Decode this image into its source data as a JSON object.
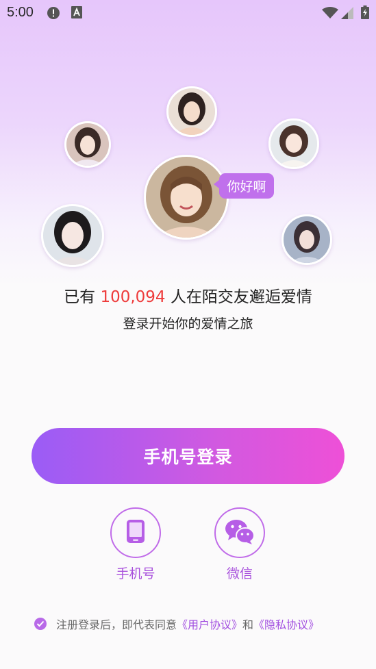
{
  "status_bar": {
    "time": "5:00"
  },
  "hero": {
    "bubble_text": "你好啊",
    "headline_prefix": "已有",
    "user_count": "100,094",
    "headline_suffix": "人在陌交友邂逅爱情",
    "subtitle": "登录开始你的爱情之旅"
  },
  "login": {
    "primary_button": "手机号登录",
    "options": [
      {
        "label": "手机号",
        "icon": "phone-icon"
      },
      {
        "label": "微信",
        "icon": "wechat-icon"
      }
    ]
  },
  "agreement": {
    "checked": true,
    "text_prefix": "注册登录后，即代表同意",
    "user_agreement": "《用户协议》",
    "and": "和",
    "privacy_policy": "《隐私协议》"
  },
  "colors": {
    "accent": "#a850dc",
    "gradient_start": "#9a5cf6",
    "gradient_end": "#ee50d7",
    "count_red": "#ee3b3b",
    "bubble": "#c070ec"
  }
}
